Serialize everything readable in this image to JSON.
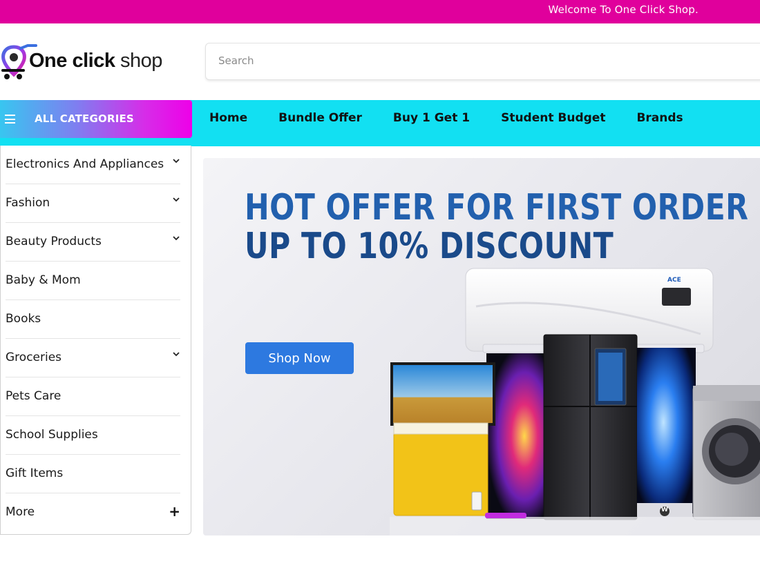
{
  "topbar": {
    "welcome": "Welcome To One Click Shop.",
    "color": "#e0009c"
  },
  "logo": {
    "brand_bold": "One click",
    "brand_light": "shop"
  },
  "search": {
    "placeholder": "Search"
  },
  "nav": {
    "all_categories": "ALL CATEGORIES",
    "links": [
      "Home",
      "Bundle Offer",
      "Buy 1 Get 1",
      "Student Budget",
      "Brands"
    ],
    "bar_color": "#12e0f2"
  },
  "categories": [
    {
      "label": "Electronics And Appliances",
      "icon": "chevron-down-icon"
    },
    {
      "label": "Fashion",
      "icon": "chevron-down-icon"
    },
    {
      "label": "Beauty Products",
      "icon": "chevron-down-icon"
    },
    {
      "label": "Baby & Mom",
      "icon": ""
    },
    {
      "label": "Books",
      "icon": ""
    },
    {
      "label": "Groceries",
      "icon": "chevron-down-icon"
    },
    {
      "label": "Pets Care",
      "icon": ""
    },
    {
      "label": "School Supplies",
      "icon": ""
    },
    {
      "label": "Gift Items",
      "icon": ""
    },
    {
      "label": "More",
      "icon": "plus-icon"
    }
  ],
  "banner": {
    "line1": "HOT OFFER FOR FIRST ORDER",
    "line2": "UP TO 10% DISCOUNT",
    "button": "Shop Now",
    "ac_brand": "ACE",
    "brand_badge": "W",
    "button_color": "#2d79e0"
  }
}
